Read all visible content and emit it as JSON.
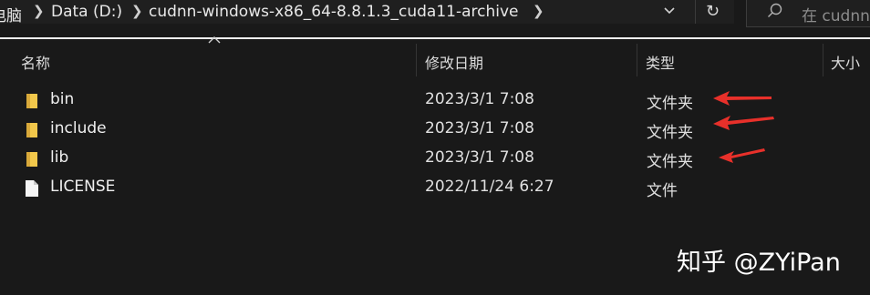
{
  "address_bar": {
    "crumbs": [
      "电脑",
      "Data (D:)",
      "cudnn-windows-x86_64-8.8.1.3_cuda11-archive"
    ]
  },
  "search": {
    "placeholder": "在 cudnn"
  },
  "columns": {
    "name": "名称",
    "modified": "修改日期",
    "type": "类型",
    "size": "大小"
  },
  "files": [
    {
      "name": "bin",
      "modified": "2023/3/1 7:08",
      "type": "文件夹",
      "icon": "folder-icon"
    },
    {
      "name": "include",
      "modified": "2023/3/1 7:08",
      "type": "文件夹",
      "icon": "folder-icon"
    },
    {
      "name": "lib",
      "modified": "2023/3/1 7:08",
      "type": "文件夹",
      "icon": "folder-icon"
    },
    {
      "name": "LICENSE",
      "modified": "2022/11/24 6:27",
      "type": "文件",
      "icon": "file-icon"
    }
  ],
  "watermark": "知乎 @ZYiPan",
  "colors": {
    "background": "#191919",
    "folder": "#f2c84b",
    "annotation_arrow": "#e8302a"
  }
}
